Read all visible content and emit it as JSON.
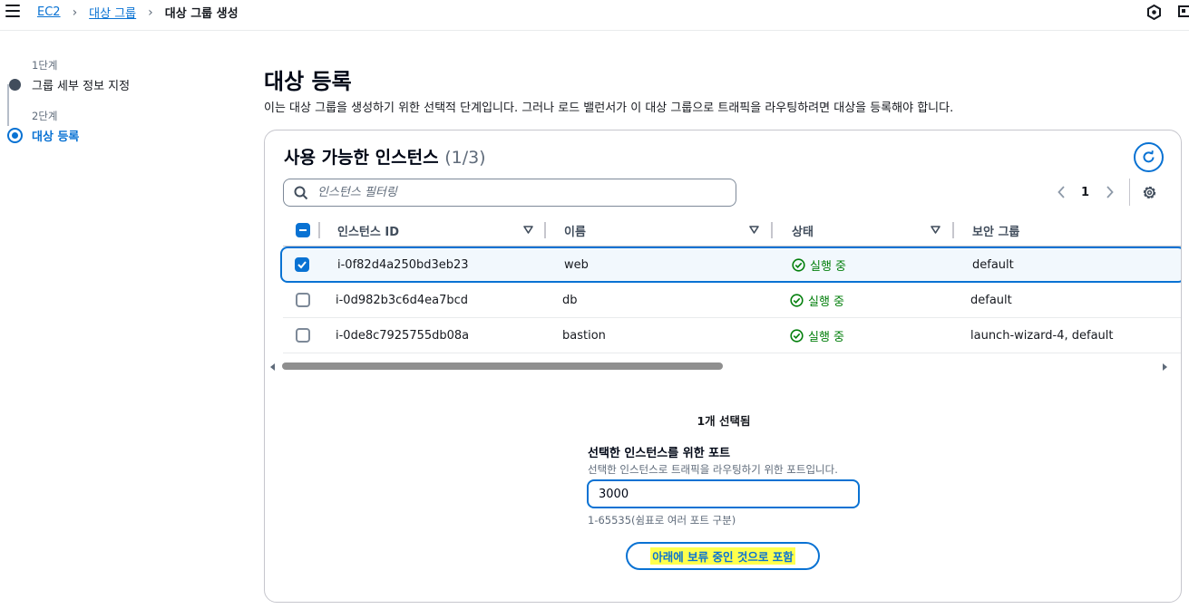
{
  "breadcrumb": {
    "items": [
      "EC2",
      "대상 그룹"
    ],
    "current": "대상 그룹 생성"
  },
  "steps": [
    {
      "number": "1단계",
      "title": "그룹 세부 정보 지정"
    },
    {
      "number": "2단계",
      "title": "대상 등록"
    }
  ],
  "page": {
    "title": "대상 등록",
    "description": "이는 대상 그룹을 생성하기 위한 선택적 단계입니다. 그러나 로드 밸런서가 이 대상 그룹으로 트래픽을 라우팅하려면 대상을 등록해야 합니다."
  },
  "instances": {
    "title": "사용 가능한 인스턴스",
    "count": "(1/3)",
    "filter_placeholder": "인스턴스 필터링",
    "page_number": "1",
    "columns": [
      "인스턴스 ID",
      "이름",
      "상태",
      "보안 그룹"
    ],
    "rows": [
      {
        "id": "i-0f82d4a250bd3eb23",
        "name": "web",
        "status": "실행 중",
        "security_group": "default",
        "selected": true
      },
      {
        "id": "i-0d982b3c6d4ea7bcd",
        "name": "db",
        "status": "실행 중",
        "security_group": "default",
        "selected": false
      },
      {
        "id": "i-0de8c7925755db08a",
        "name": "bastion",
        "status": "실행 중",
        "security_group": "launch-wizard-4, default",
        "selected": false
      }
    ]
  },
  "selection": {
    "count_text": "1개 선택됨",
    "port_label": "선택한 인스턴스를 위한 포트",
    "port_description": "선택한 인스턴스로 트래픽을 라우팅하기 위한 포트입니다.",
    "port_value": "3000",
    "port_hint": "1-65535(쉼표로 여러 포트 구분)",
    "include_button": "아래에 보류 중인 것으로 포함"
  },
  "colors": {
    "accent": "#0972d3",
    "status_running": "#037f0c",
    "highlight": "#ffff4d"
  }
}
